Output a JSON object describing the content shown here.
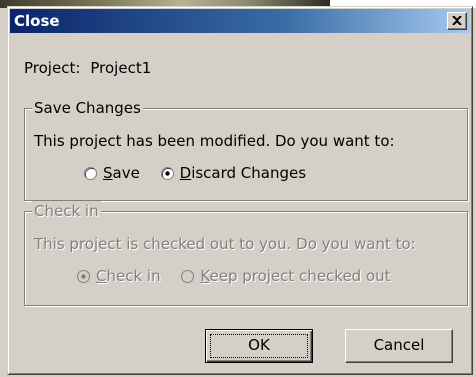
{
  "window": {
    "title": "Close"
  },
  "project": {
    "label": "Project:",
    "value": "Project1"
  },
  "save_changes": {
    "legend": "Save Changes",
    "description": "This project has been modified. Do you want to:",
    "options": [
      {
        "label": "Save",
        "accel": "S",
        "rest": "ave",
        "selected": false
      },
      {
        "label": "Discard Changes",
        "accel": "D",
        "rest": "iscard Changes",
        "selected": true
      }
    ]
  },
  "check_in": {
    "legend": "Check in",
    "description": "This project is checked out to you. Do you want to:",
    "enabled": false,
    "options": [
      {
        "label": "Check in",
        "accel": "C",
        "rest": "heck in",
        "selected": true
      },
      {
        "label": "Keep project checked out",
        "accel": "K",
        "rest": "eep project checked out",
        "selected": false
      }
    ]
  },
  "buttons": {
    "ok": "OK",
    "cancel": "Cancel"
  },
  "icons": {
    "close": "close-icon",
    "radio": "radio-button-icon"
  },
  "colors": {
    "titlebar_start": "#0a246a",
    "titlebar_end": "#a6caf0",
    "face": "#d4d0c8"
  }
}
